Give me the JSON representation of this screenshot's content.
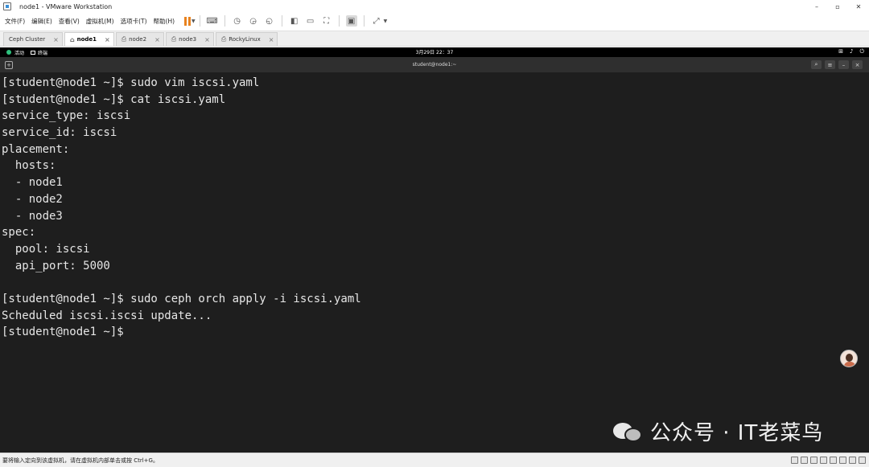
{
  "window": {
    "title": "node1 - VMware Workstation",
    "minimize": "–",
    "maximize": "▫",
    "close": "✕"
  },
  "menu": {
    "items": [
      "文件(F)",
      "编辑(E)",
      "查看(V)",
      "虚拟机(M)",
      "选项卡(T)",
      "帮助(H)"
    ]
  },
  "tabs": [
    {
      "label": "Ceph Cluster",
      "active": false
    },
    {
      "label": "node1",
      "active": true
    },
    {
      "label": "node2",
      "active": false
    },
    {
      "label": "node3",
      "active": false
    },
    {
      "label": "RockyLinux",
      "active": false
    }
  ],
  "guest_panel": {
    "activities": "活动",
    "terminal_app": "终端",
    "clock": "3月29日  22：37"
  },
  "terminal": {
    "title": "student@node1:~",
    "lines": [
      "[student@node1 ~]$ sudo vim iscsi.yaml",
      "[student@node1 ~]$ cat iscsi.yaml",
      "service_type: iscsi",
      "service_id: iscsi",
      "placement:",
      "  hosts:",
      "  - node1",
      "  - node2",
      "  - node3",
      "spec:",
      "  pool: iscsi",
      "  api_port: 5000",
      "",
      "[student@node1 ~]$ sudo ceph orch apply -i iscsi.yaml",
      "Scheduled iscsi.iscsi update...",
      "[student@node1 ~]$ "
    ]
  },
  "watermark": {
    "text": "公众号 · IT老菜鸟"
  },
  "statusbar": {
    "text": "要将输入定向到该虚拟机，请在虚拟机内部单击或按 Ctrl+G。"
  }
}
